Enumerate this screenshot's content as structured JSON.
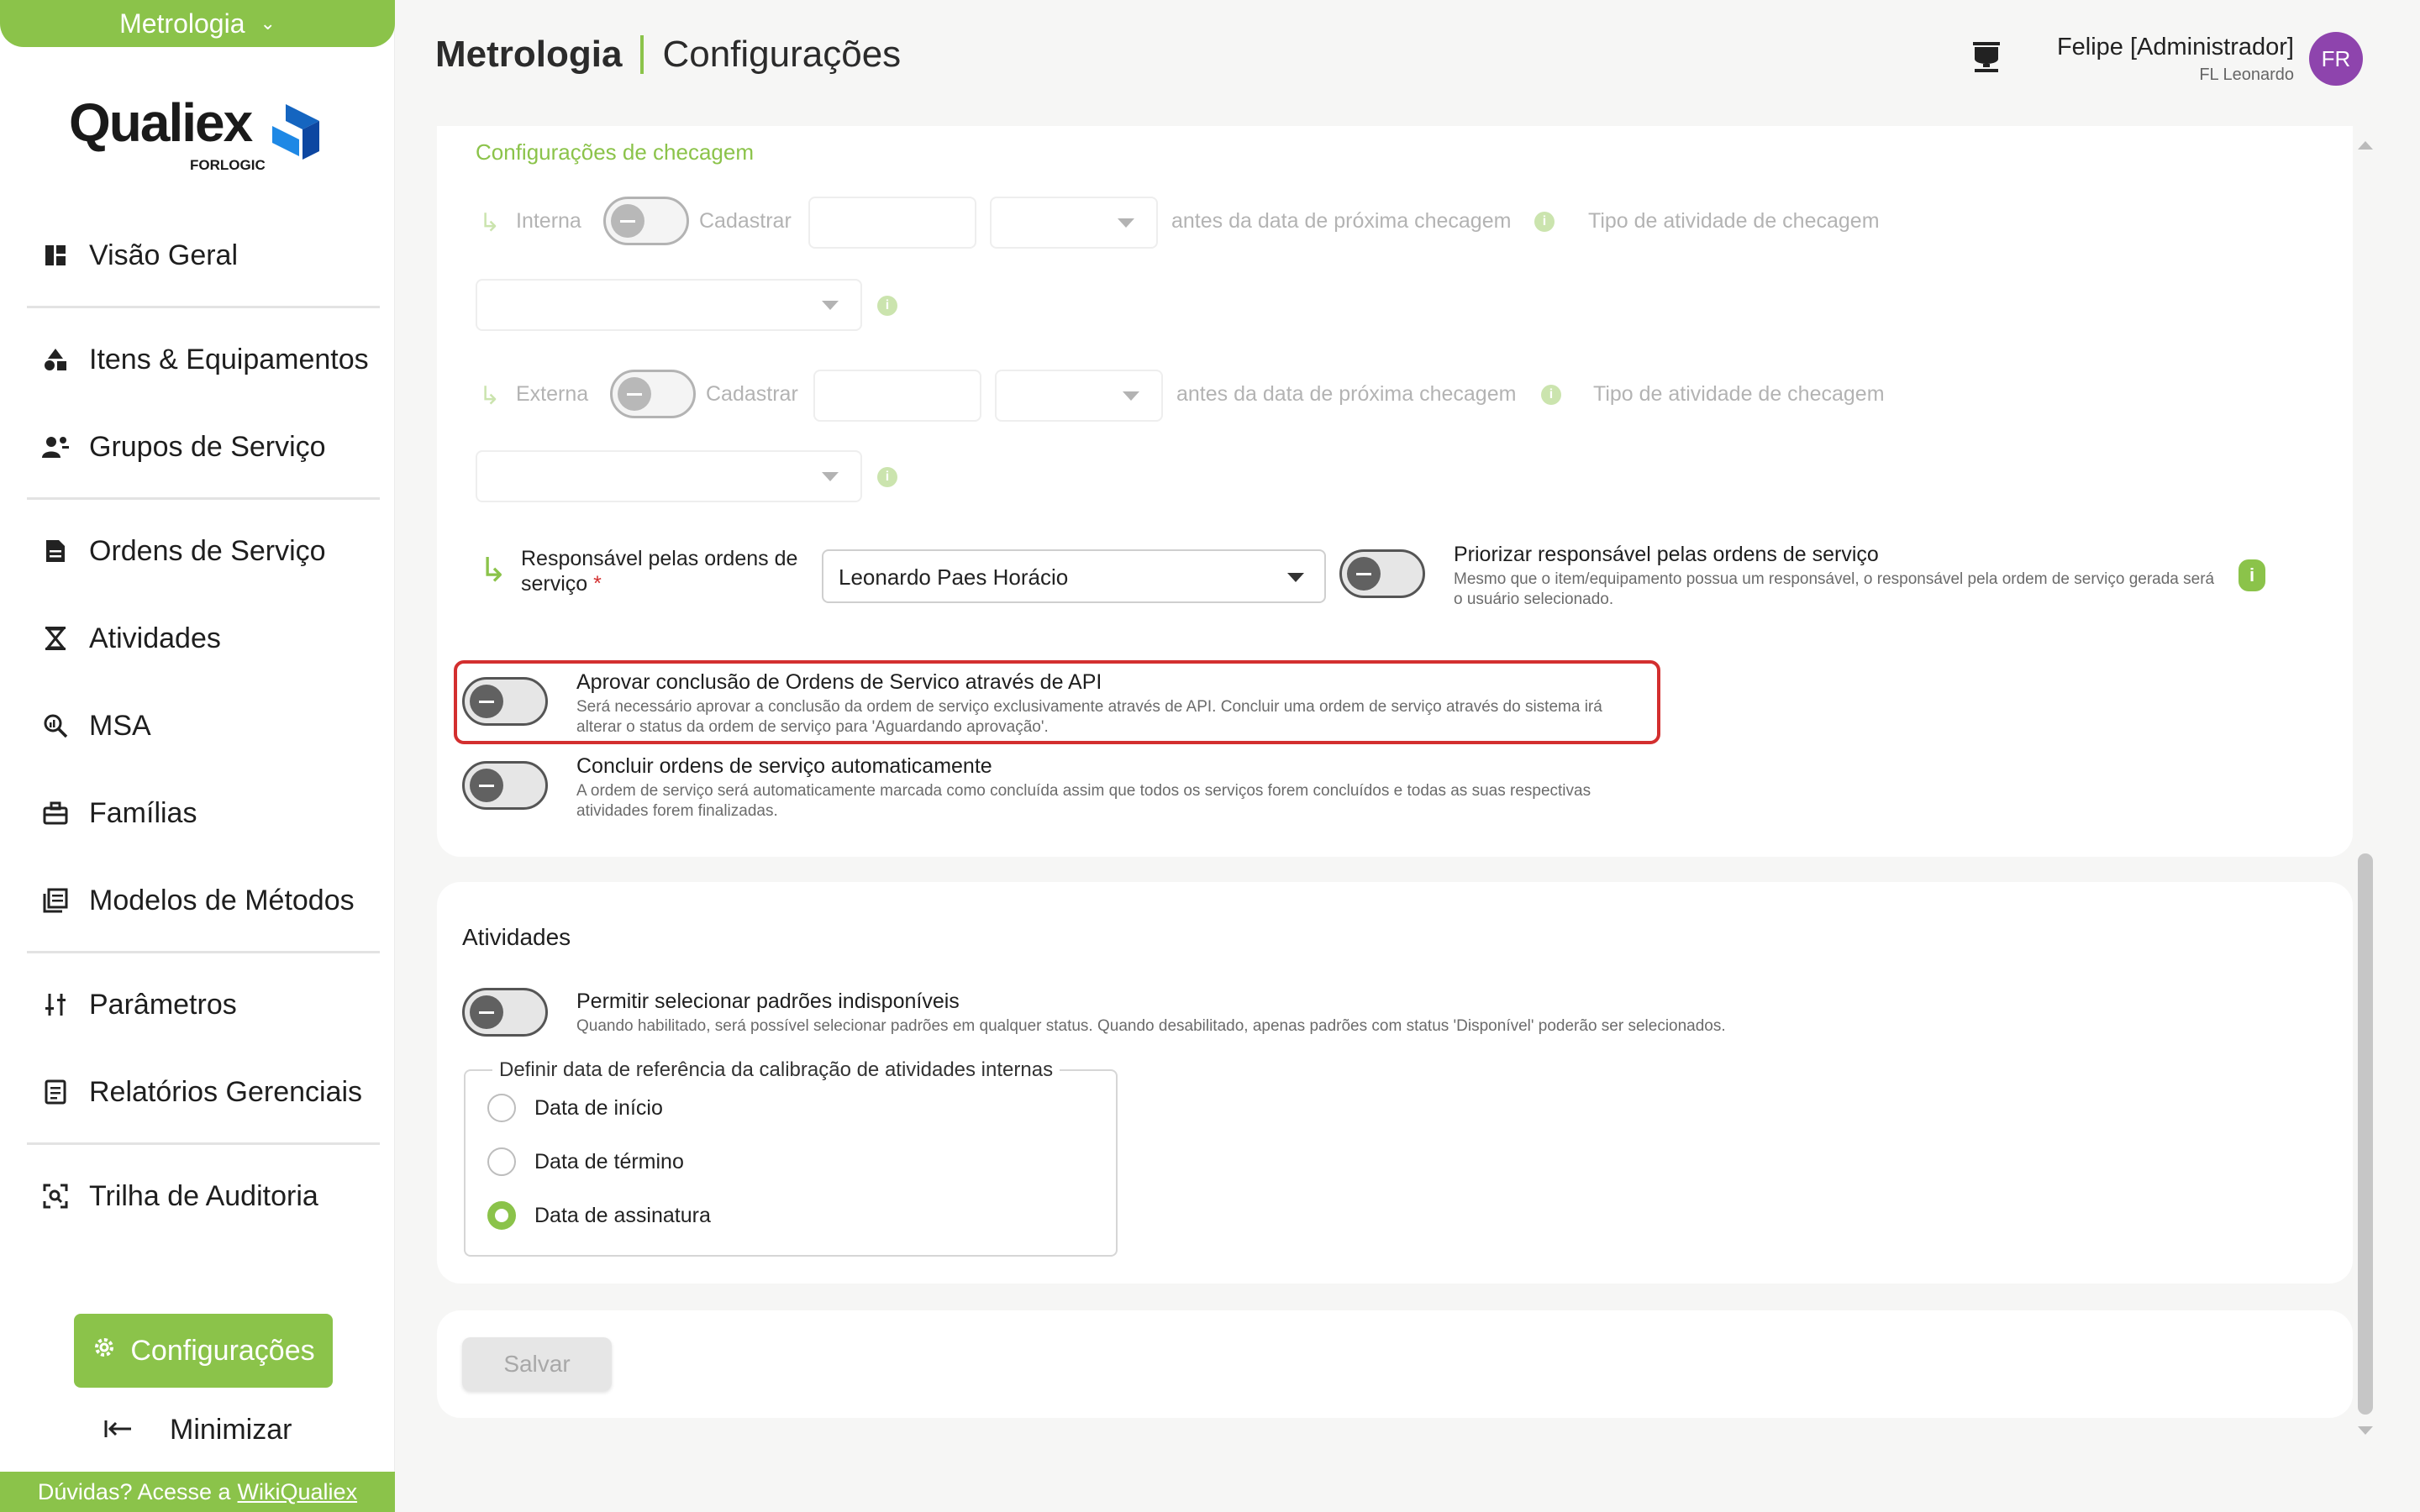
{
  "sidebar": {
    "module_label": "Metrologia",
    "logo_text": "Qualiex",
    "logo_sub": "FORLOGIC",
    "items": [
      {
        "label": "Visão Geral",
        "icon": "dashboard-icon"
      },
      {
        "label": "Itens & Equipamentos",
        "icon": "shapes-icon"
      },
      {
        "label": "Grupos de Serviço",
        "icon": "group-icon"
      },
      {
        "label": "Ordens de Serviço",
        "icon": "document-icon"
      },
      {
        "label": "Atividades",
        "icon": "hourglass-icon"
      },
      {
        "label": "MSA",
        "icon": "magnifier-chart-icon"
      },
      {
        "label": "Famílias",
        "icon": "toolbox-icon"
      },
      {
        "label": "Modelos de Métodos",
        "icon": "library-icon"
      },
      {
        "label": "Parâmetros",
        "icon": "sliders-icon"
      },
      {
        "label": "Relatórios Gerenciais",
        "icon": "report-icon"
      },
      {
        "label": "Trilha de Auditoria",
        "icon": "scan-icon"
      }
    ],
    "config_label": "Configurações",
    "minimize_label": "Minimizar",
    "footer_text": "Dúvidas? Acesse a",
    "footer_link": "WikiQualiex"
  },
  "header": {
    "module": "Metrologia",
    "page": "Configurações",
    "user_name": "Felipe [Administrador]",
    "user_sub": "FL Leonardo",
    "avatar_initials": "FR"
  },
  "check_config": {
    "section_title": "Configurações de checagem",
    "internal_label": "Interna",
    "external_label": "Externa",
    "register_label": "Cadastrar",
    "before_date_label": "antes da data de próxima checagem",
    "activity_type_label": "Tipo de atividade de checagem",
    "responsible_label": "Responsável pelas ordens de serviço",
    "responsible_required": "*",
    "responsible_value": "Leonardo Paes Horácio",
    "prioritize_title": "Priorizar responsável pelas ordens de serviço",
    "prioritize_desc": "Mesmo que o item/equipamento possua um responsável, o responsável pela ordem de serviço gerada será o usuário selecionado."
  },
  "options": {
    "approve_api_title": "Aprovar conclusão de Ordens de Servico através de API",
    "approve_api_desc": "Será necessário aprovar a conclusão da ordem de serviço exclusivamente através de API. Concluir uma ordem de serviço através do sistema irá alterar o status da ordem de serviço para 'Aguardando aprovação'.",
    "auto_complete_title": "Concluir ordens de serviço automaticamente",
    "auto_complete_desc": "A ordem de serviço será automaticamente marcada como concluída assim que todos os serviços forem concluídos e todas as suas respectivas atividades forem finalizadas."
  },
  "activities": {
    "title": "Atividades",
    "unavailable_title": "Permitir selecionar padrões indisponíveis",
    "unavailable_desc": "Quando habilitado, será possível selecionar padrões em qualquer status. Quando desabilitado, apenas padrões com status 'Disponível' poderão ser selecionados.",
    "ref_legend": "Definir data de referência da calibração de atividades internas",
    "radios": [
      {
        "label": "Data de início",
        "selected": false
      },
      {
        "label": "Data de término",
        "selected": false
      },
      {
        "label": "Data de assinatura",
        "selected": true
      }
    ]
  },
  "actions": {
    "save_label": "Salvar"
  },
  "colors": {
    "accent": "#8bc34a",
    "highlight": "#d32f2f",
    "avatar": "#8e44ad"
  }
}
